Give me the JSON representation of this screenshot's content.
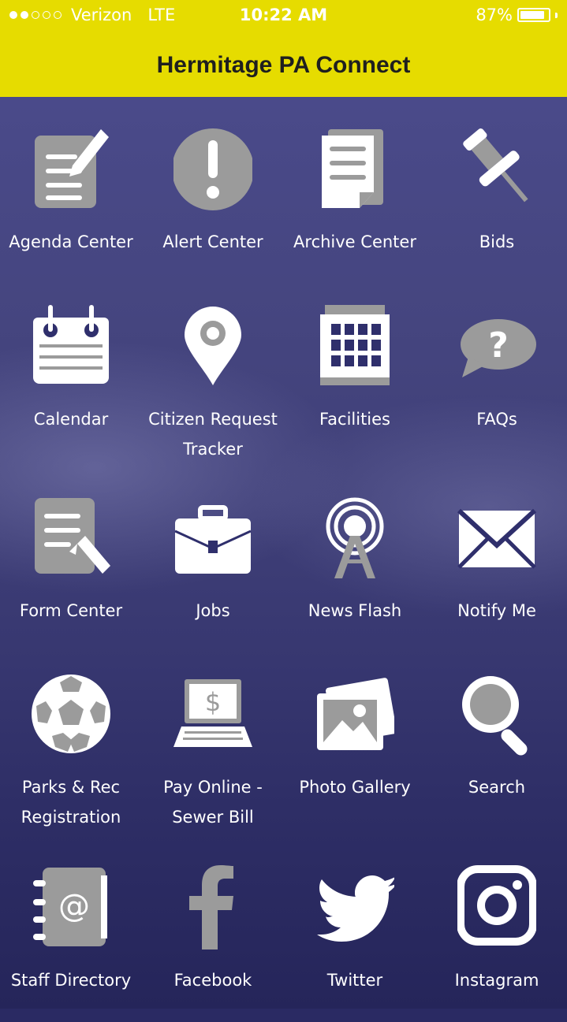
{
  "status_bar": {
    "signal_dots": [
      true,
      true,
      false,
      false,
      false
    ],
    "carrier": "Verizon",
    "network": "LTE",
    "time": "10:22 AM",
    "battery_percent": "87%",
    "battery_level": 0.87
  },
  "header": {
    "title": "Hermitage PA Connect",
    "background": "#e6dc00"
  },
  "tiles": [
    {
      "label": "Agenda Center",
      "icon": "agenda-icon"
    },
    {
      "label": "Alert Center",
      "icon": "alert-icon"
    },
    {
      "label": "Archive Center",
      "icon": "archive-icon"
    },
    {
      "label": "Bids",
      "icon": "pushpin-icon"
    },
    {
      "label": "Calendar",
      "icon": "calendar-icon"
    },
    {
      "label": "Citizen Request Tracker",
      "icon": "location-pin-icon"
    },
    {
      "label": "Facilities",
      "icon": "building-icon"
    },
    {
      "label": "FAQs",
      "icon": "question-bubble-icon"
    },
    {
      "label": "Form Center",
      "icon": "form-icon"
    },
    {
      "label": "Jobs",
      "icon": "briefcase-icon"
    },
    {
      "label": "News Flash",
      "icon": "broadcast-tower-icon"
    },
    {
      "label": "Notify Me",
      "icon": "envelope-icon"
    },
    {
      "label": "Parks & Rec Registration",
      "icon": "soccer-ball-icon"
    },
    {
      "label": "Pay Online - Sewer Bill",
      "icon": "laptop-dollar-icon"
    },
    {
      "label": "Photo Gallery",
      "icon": "photo-icon"
    },
    {
      "label": "Search",
      "icon": "magnifier-icon"
    },
    {
      "label": "Staff Directory",
      "icon": "address-book-icon"
    },
    {
      "label": "Facebook",
      "icon": "facebook-icon"
    },
    {
      "label": "Twitter",
      "icon": "twitter-icon"
    },
    {
      "label": "Instagram",
      "icon": "instagram-icon"
    }
  ]
}
